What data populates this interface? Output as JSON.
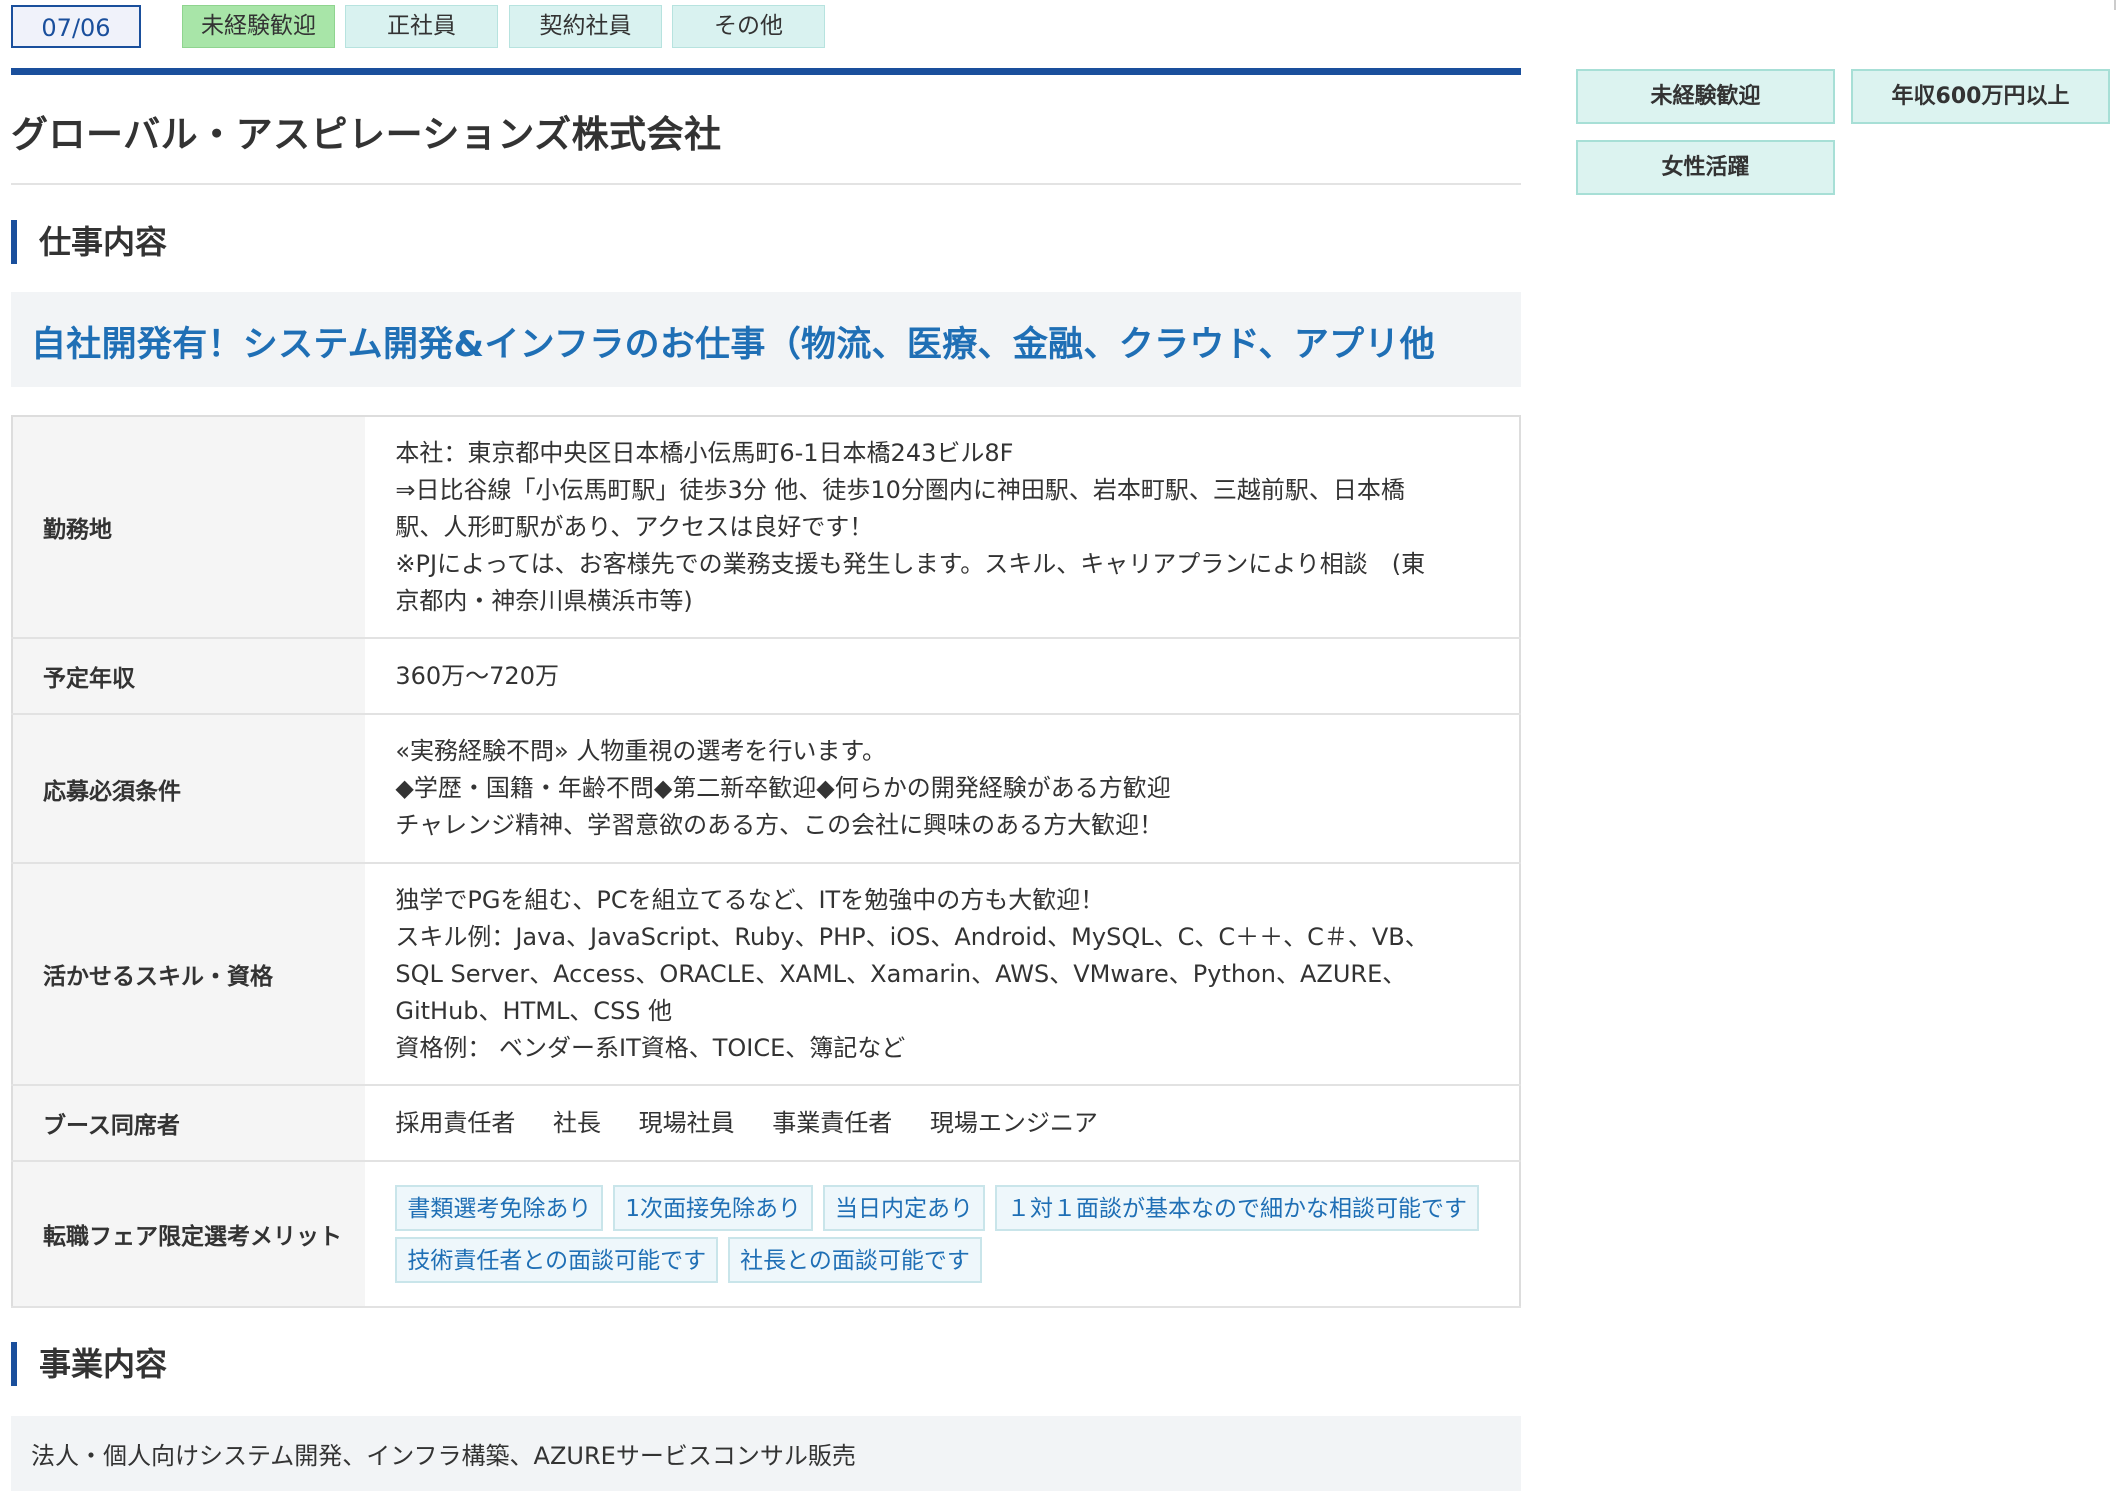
{
  "top_tags": {
    "date": "07/06",
    "tags": [
      "未経験歓迎",
      "正社員",
      "契約社員",
      "その他"
    ]
  },
  "company": {
    "name": "グローバル・アスピレーションズ株式会社"
  },
  "job_section": {
    "heading": "仕事内容",
    "title": "自社開発有！システム開発&インフラのお仕事（物流、医療、金融、クラウド、アプリ他"
  },
  "details": {
    "location": {
      "label": "勤務地",
      "lines": [
        "本社：東京都中央区日本橋小伝馬町6-1日本橋243ビル8F",
        "⇒日比谷線「小伝馬町駅」徒歩3分 他、徒歩10分圏内に神田駅、岩本町駅、三越前駅、日本橋",
        "駅、人形町駅があり、アクセスは良好です！",
        "※PJによっては、お客様先での業務支援も発生します。スキル、キャリアプランにより相談　(東",
        "京都内・神奈川県横浜市等)"
      ]
    },
    "salary": {
      "label": "予定年収",
      "value": "360万～720万"
    },
    "requirements": {
      "label": "応募必須条件",
      "lines": [
        "«実務経験不問» 人物重視の選考を行います。",
        "◆学歴・国籍・年齢不問◆第二新卒歓迎◆何らかの開発経験がある方歓迎",
        "チャレンジ精神、学習意欲のある方、この会社に興味のある方大歓迎！"
      ]
    },
    "skills": {
      "label": "活かせるスキル・資格",
      "lines": [
        "独学でPGを組む、PCを組立てるなど、ITを勉強中の方も大歓迎！",
        "スキル例：Java、JavaScript、Ruby、PHP、iOS、Android、MySQL、C、C＋＋、C＃、VB、",
        "SQL Server、Access、ORACLE、XAML、Xamarin、AWS、VMware、Python、AZURE、",
        "GitHub、HTML、CSS 他",
        "資格例： ベンダー系IT資格、TOICE、簿記など"
      ]
    },
    "attendees": {
      "label": "ブース同席者",
      "items": [
        "採用責任者",
        "社長",
        "現場社員",
        "事業責任者",
        "現場エンジニア"
      ]
    },
    "merits": {
      "label": "転職フェア限定選考メリット",
      "items": [
        "書類選考免除あり",
        "1次面接免除あり",
        "当日内定あり",
        "１対１面談が基本なので細かな相談可能です",
        "技術責任者との面談可能です",
        "社長との面談可能です"
      ]
    }
  },
  "business_section": {
    "heading": "事業内容",
    "text": "法人・個人向けシステム開発、インフラ構築、AZUREサービスコンサル販売"
  },
  "side_tags": [
    "未経験歓迎",
    "年収600万円以上",
    "女性活躍"
  ]
}
